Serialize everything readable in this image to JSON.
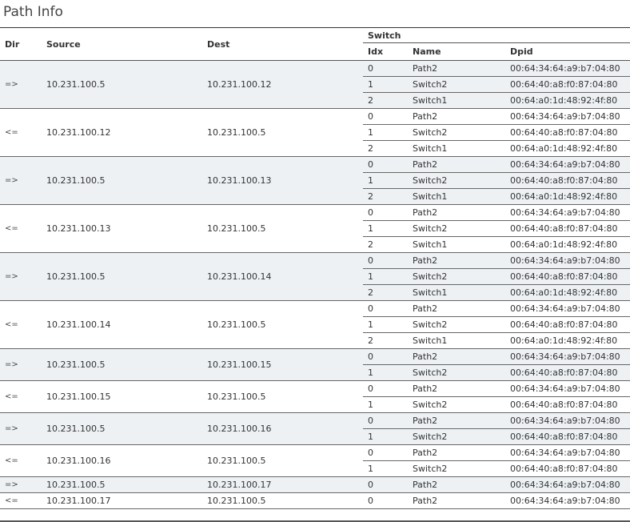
{
  "title": "Path Info",
  "columns": {
    "dir": "Dir",
    "source": "Source",
    "dest": "Dest",
    "switch": "Switch",
    "idx": "Idx",
    "name": "Name",
    "dpid": "Dpid"
  },
  "paths": [
    {
      "dir": "=>",
      "source": "10.231.100.5",
      "dest": "10.231.100.12",
      "switches": [
        {
          "idx": "0",
          "name": "Path2",
          "dpid": "00:64:34:64:a9:b7:04:80"
        },
        {
          "idx": "1",
          "name": "Switch2",
          "dpid": "00:64:40:a8:f0:87:04:80"
        },
        {
          "idx": "2",
          "name": "Switch1",
          "dpid": "00:64:a0:1d:48:92:4f:80"
        }
      ]
    },
    {
      "dir": "<=",
      "source": "10.231.100.12",
      "dest": "10.231.100.5",
      "switches": [
        {
          "idx": "0",
          "name": "Path2",
          "dpid": "00:64:34:64:a9:b7:04:80"
        },
        {
          "idx": "1",
          "name": "Switch2",
          "dpid": "00:64:40:a8:f0:87:04:80"
        },
        {
          "idx": "2",
          "name": "Switch1",
          "dpid": "00:64:a0:1d:48:92:4f:80"
        }
      ]
    },
    {
      "dir": "=>",
      "source": "10.231.100.5",
      "dest": "10.231.100.13",
      "switches": [
        {
          "idx": "0",
          "name": "Path2",
          "dpid": "00:64:34:64:a9:b7:04:80"
        },
        {
          "idx": "1",
          "name": "Switch2",
          "dpid": "00:64:40:a8:f0:87:04:80"
        },
        {
          "idx": "2",
          "name": "Switch1",
          "dpid": "00:64:a0:1d:48:92:4f:80"
        }
      ]
    },
    {
      "dir": "<=",
      "source": "10.231.100.13",
      "dest": "10.231.100.5",
      "switches": [
        {
          "idx": "0",
          "name": "Path2",
          "dpid": "00:64:34:64:a9:b7:04:80"
        },
        {
          "idx": "1",
          "name": "Switch2",
          "dpid": "00:64:40:a8:f0:87:04:80"
        },
        {
          "idx": "2",
          "name": "Switch1",
          "dpid": "00:64:a0:1d:48:92:4f:80"
        }
      ]
    },
    {
      "dir": "=>",
      "source": "10.231.100.5",
      "dest": "10.231.100.14",
      "switches": [
        {
          "idx": "0",
          "name": "Path2",
          "dpid": "00:64:34:64:a9:b7:04:80"
        },
        {
          "idx": "1",
          "name": "Switch2",
          "dpid": "00:64:40:a8:f0:87:04:80"
        },
        {
          "idx": "2",
          "name": "Switch1",
          "dpid": "00:64:a0:1d:48:92:4f:80"
        }
      ]
    },
    {
      "dir": "<=",
      "source": "10.231.100.14",
      "dest": "10.231.100.5",
      "switches": [
        {
          "idx": "0",
          "name": "Path2",
          "dpid": "00:64:34:64:a9:b7:04:80"
        },
        {
          "idx": "1",
          "name": "Switch2",
          "dpid": "00:64:40:a8:f0:87:04:80"
        },
        {
          "idx": "2",
          "name": "Switch1",
          "dpid": "00:64:a0:1d:48:92:4f:80"
        }
      ]
    },
    {
      "dir": "=>",
      "source": "10.231.100.5",
      "dest": "10.231.100.15",
      "switches": [
        {
          "idx": "0",
          "name": "Path2",
          "dpid": "00:64:34:64:a9:b7:04:80"
        },
        {
          "idx": "1",
          "name": "Switch2",
          "dpid": "00:64:40:a8:f0:87:04:80"
        }
      ]
    },
    {
      "dir": "<=",
      "source": "10.231.100.15",
      "dest": "10.231.100.5",
      "switches": [
        {
          "idx": "0",
          "name": "Path2",
          "dpid": "00:64:34:64:a9:b7:04:80"
        },
        {
          "idx": "1",
          "name": "Switch2",
          "dpid": "00:64:40:a8:f0:87:04:80"
        }
      ]
    },
    {
      "dir": "=>",
      "source": "10.231.100.5",
      "dest": "10.231.100.16",
      "switches": [
        {
          "idx": "0",
          "name": "Path2",
          "dpid": "00:64:34:64:a9:b7:04:80"
        },
        {
          "idx": "1",
          "name": "Switch2",
          "dpid": "00:64:40:a8:f0:87:04:80"
        }
      ]
    },
    {
      "dir": "<=",
      "source": "10.231.100.16",
      "dest": "10.231.100.5",
      "switches": [
        {
          "idx": "0",
          "name": "Path2",
          "dpid": "00:64:34:64:a9:b7:04:80"
        },
        {
          "idx": "1",
          "name": "Switch2",
          "dpid": "00:64:40:a8:f0:87:04:80"
        }
      ]
    },
    {
      "dir": "=>",
      "source": "10.231.100.5",
      "dest": "10.231.100.17",
      "switches": [
        {
          "idx": "0",
          "name": "Path2",
          "dpid": "00:64:34:64:a9:b7:04:80"
        }
      ]
    },
    {
      "dir": "<=",
      "source": "10.231.100.17",
      "dest": "10.231.100.5",
      "switches": [
        {
          "idx": "0",
          "name": "Path2",
          "dpid": "00:64:34:64:a9:b7:04:80"
        }
      ]
    }
  ]
}
